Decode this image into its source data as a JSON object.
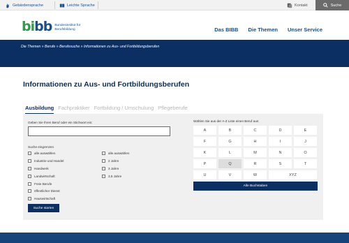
{
  "utilbar": {
    "sign_language": "Gebärdensprache",
    "easy_language": "Leichte Sprache",
    "contact": "Kontakt",
    "search": "Suche"
  },
  "logo": {
    "mark": "bibb",
    "line1": "Bundesinstitut für",
    "line2": "Berufsbildung"
  },
  "mainnav": {
    "items": [
      "Das BIBB",
      "Die Themen",
      "Unser Service"
    ]
  },
  "breadcrumb": "Die Themen » Berufe » Berufesuche » Informationen zu Aus- und Fortbildungsberufen",
  "page_title": "Informationen zu Aus- und Fortbildungsberufen",
  "tabs": [
    "Ausbildung",
    "Fachpraktiker",
    "Fortbildung / Umschulung",
    "Pflegeberufe"
  ],
  "form": {
    "input_label": "Geben Sie Ihren Beruf oder ein Stichwort ein:",
    "input_value": "",
    "refine_label": "Suche eingrenzen",
    "col1": [
      "alle auswählen",
      "Industrie und Handel",
      "Handwerk",
      "Landwirtschaft",
      "Freie Berufe",
      "öffentlicher Dienst",
      "Hauswirtschaft"
    ],
    "col2": [
      "alle auswählen",
      "2 Jahre",
      "3 Jahre",
      "3,5 Jahre"
    ],
    "submit": "Suche starten"
  },
  "az": {
    "label": "Wählen Sie aus der A-Z Liste einen Beruf aus:",
    "rows": [
      [
        "A",
        "B",
        "C",
        "D",
        "E"
      ],
      [
        "F",
        "G",
        "H",
        "I",
        "J"
      ],
      [
        "K",
        "L",
        "M",
        "N",
        "O"
      ],
      [
        "P",
        "Q",
        "R",
        "S",
        "T"
      ],
      [
        "U",
        "V",
        "W",
        "XYZ"
      ]
    ],
    "disabled": [
      "Q"
    ],
    "all_button": "Alle Buchstaben"
  },
  "colors": {
    "navy": "#0b2f62",
    "brand_green": "#2e9d4a",
    "brand_blue": "#1a4f8b"
  }
}
